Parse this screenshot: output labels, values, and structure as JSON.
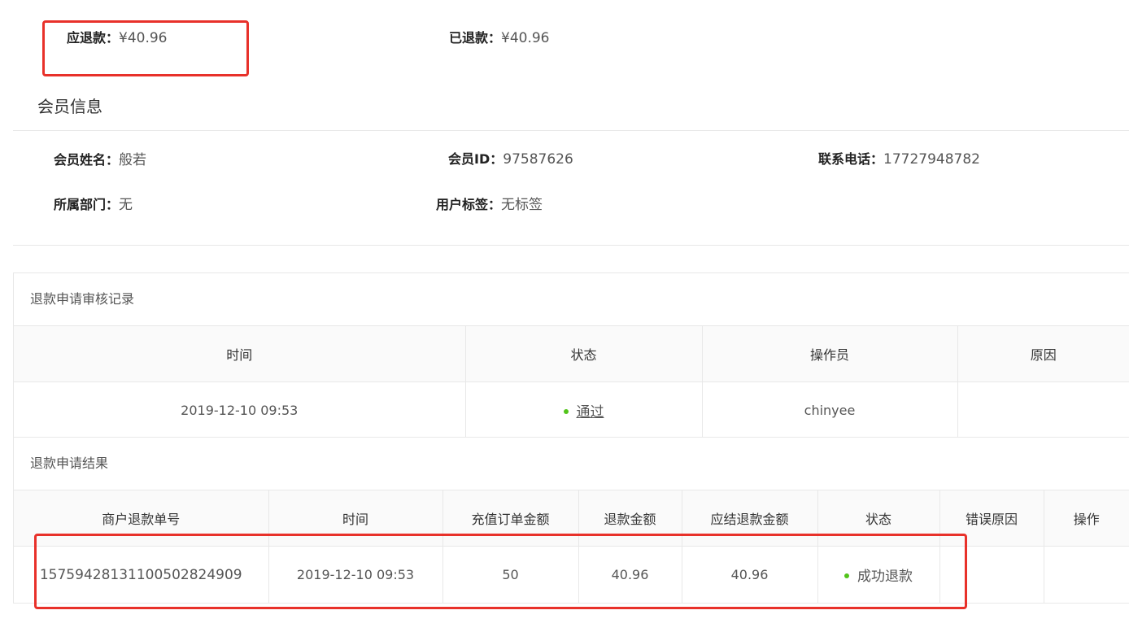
{
  "refund": {
    "due_label": "应退款：",
    "due_value": "¥40.96",
    "refunded_label": "已退款：",
    "refunded_value": "¥40.96"
  },
  "member": {
    "title": "会员信息",
    "name_label": "会员姓名：",
    "name_value": "般若",
    "id_label": "会员ID：",
    "id_value": "97587626",
    "phone_label": "联系电话：",
    "phone_value": "17727948782",
    "dept_label": "所属部门：",
    "dept_value": "无",
    "tag_label": "用户标签：",
    "tag_value": "无标签"
  },
  "audit": {
    "title": "退款申请审核记录",
    "headers": [
      "时间",
      "状态",
      "操作员",
      "原因"
    ],
    "rows": [
      {
        "time": "2019-12-10 09:53",
        "status": "通过",
        "operator": "chinyee",
        "reason": ""
      }
    ]
  },
  "result": {
    "title": "退款申请结果",
    "headers": [
      "商户退款单号",
      "时间",
      "充值订单金额",
      "退款金额",
      "应结退款金额",
      "状态",
      "错误原因",
      "操作"
    ],
    "rows": [
      {
        "order_no": "15759428131100502824909",
        "time": "2019-12-10 09:53",
        "order_amount": "50",
        "refund_amount": "40.96",
        "settle_amount": "40.96",
        "status": "成功退款",
        "error": "",
        "action": ""
      }
    ]
  },
  "colors": {
    "annotation_red": "#e8312a",
    "status_green": "#52c41a"
  }
}
